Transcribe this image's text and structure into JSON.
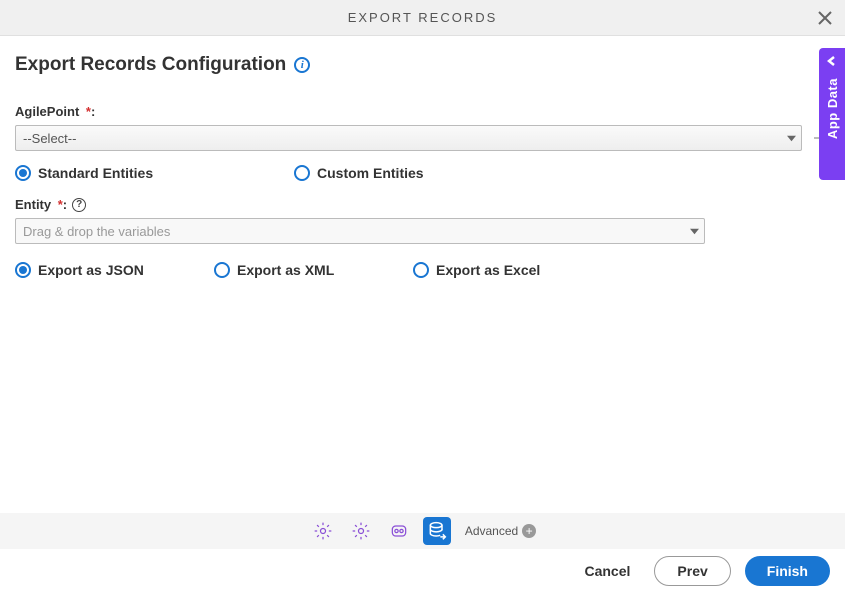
{
  "header": {
    "title": "EXPORT RECORDS"
  },
  "page": {
    "title": "Export Records Configuration"
  },
  "fields": {
    "agilepoint": {
      "label": "AgilePoint",
      "placeholder": "--Select--"
    },
    "entity_type": {
      "standard": "Standard Entities",
      "custom": "Custom Entities"
    },
    "entity": {
      "label": "Entity",
      "placeholder": "Drag & drop the variables"
    },
    "export_format": {
      "json": "Export as JSON",
      "xml": "Export as XML",
      "excel": "Export as Excel"
    }
  },
  "toolbar": {
    "advanced": "Advanced"
  },
  "footer": {
    "cancel": "Cancel",
    "prev": "Prev",
    "finish": "Finish"
  },
  "sidetab": {
    "label": "App Data"
  }
}
